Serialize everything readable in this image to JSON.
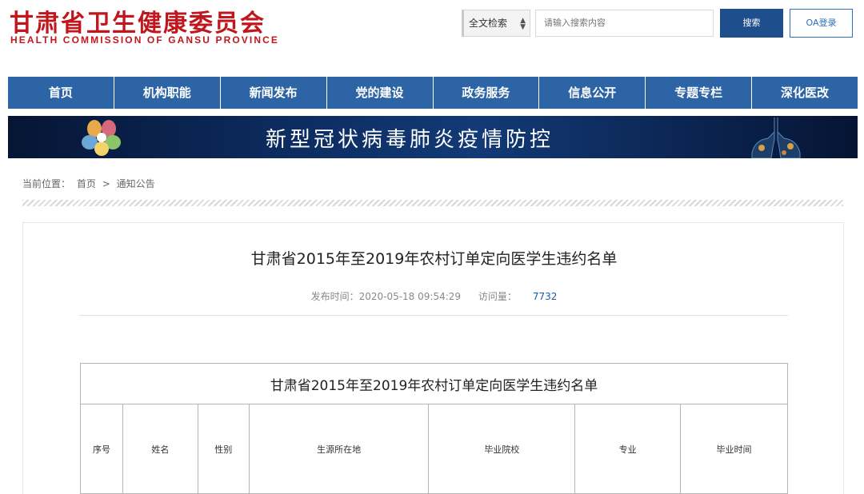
{
  "header": {
    "logo_cn": "甘肃省卫生健康委员会",
    "logo_en": "HEALTH COMMISSION OF GANSU PROVINCE",
    "search_scope": "全文检索",
    "search_placeholder": "请输入搜索内容",
    "search_button": "搜索",
    "oa_button": "OA登录"
  },
  "nav": {
    "items": [
      {
        "label": "首页"
      },
      {
        "label": "机构职能"
      },
      {
        "label": "新闻发布"
      },
      {
        "label": "党的建设"
      },
      {
        "label": "政务服务"
      },
      {
        "label": "信息公开"
      },
      {
        "label": "专题专栏"
      },
      {
        "label": "深化医改"
      }
    ]
  },
  "banner": {
    "title": "新型冠状病毒肺炎疫情防控"
  },
  "breadcrumb": {
    "label": "当前位置：",
    "home": "首页",
    "separator": ">",
    "current": "通知公告"
  },
  "article": {
    "title": "甘肃省2015年至2019年农村订单定向医学生违约名单",
    "publish_label": "发布时间：",
    "publish_time": "2020-05-18 09:54:29",
    "views_label": "访问量：",
    "views": "7732"
  },
  "table": {
    "caption": "甘肃省2015年至2019年农村订单定向医学生违约名单",
    "columns": [
      "序号",
      "姓名",
      "性别",
      "生源所在地",
      "毕业院校",
      "专业",
      "毕业时间"
    ]
  },
  "colors": {
    "brand_red": "#c0171f",
    "nav_blue": "#2c64a6",
    "button_blue": "#1f4e8c",
    "link_blue": "#1d5aa8"
  }
}
